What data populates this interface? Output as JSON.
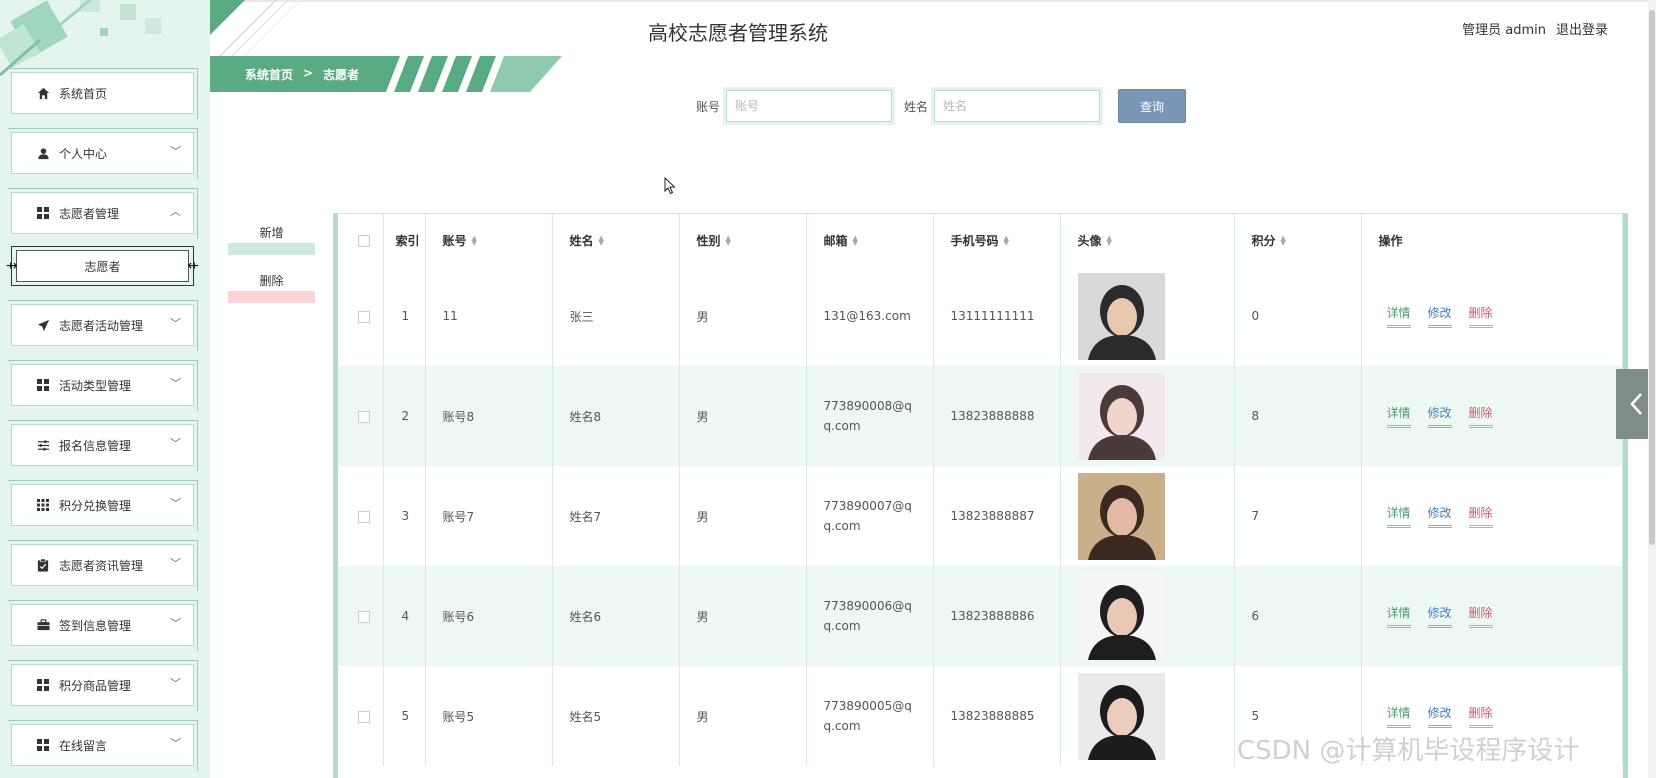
{
  "header": {
    "title": "高校志愿者管理系统",
    "user_label": "管理员 admin",
    "logout": "退出登录"
  },
  "breadcrumb": {
    "home": "系统首页",
    "sep": ">",
    "current": "志愿者"
  },
  "search": {
    "account_label": "账号",
    "account_placeholder": "账号",
    "name_label": "姓名",
    "name_placeholder": "姓名",
    "query_button": "查询"
  },
  "actions": {
    "add": "新增",
    "delete": "删除"
  },
  "sidebar": {
    "items": [
      {
        "label": "系统首页",
        "icon": "home-icon"
      },
      {
        "label": "个人中心",
        "icon": "user-icon",
        "chevron": "﹀"
      },
      {
        "label": "志愿者管理",
        "icon": "grid-icon",
        "chevron": "︿"
      },
      {
        "label": "志愿者活动管理",
        "icon": "send-icon",
        "chevron": "﹀"
      },
      {
        "label": "活动类型管理",
        "icon": "grid-icon",
        "chevron": "﹀"
      },
      {
        "label": "报名信息管理",
        "icon": "sliders-icon",
        "chevron": "﹀"
      },
      {
        "label": "积分兑换管理",
        "icon": "apps-icon",
        "chevron": "﹀"
      },
      {
        "label": "志愿者资讯管理",
        "icon": "clipboard-icon",
        "chevron": "﹀"
      },
      {
        "label": "签到信息管理",
        "icon": "briefcase-icon",
        "chevron": "﹀"
      },
      {
        "label": "积分商品管理",
        "icon": "grid-icon",
        "chevron": "﹀"
      },
      {
        "label": "在线留言",
        "icon": "grid-icon",
        "chevron": "﹀"
      }
    ],
    "active_sub": "志愿者"
  },
  "table": {
    "columns": {
      "index": "索引",
      "account": "账号",
      "name": "姓名",
      "gender": "性别",
      "email": "邮箱",
      "phone": "手机号码",
      "avatar": "头像",
      "points": "积分",
      "ops": "操作"
    },
    "op_labels": {
      "detail": "详情",
      "edit": "修改",
      "delete": "删除"
    },
    "rows": [
      {
        "index": "1",
        "account": "11",
        "name": "张三",
        "gender": "男",
        "email": "131@163.com",
        "phone": "13111111111",
        "points": "0",
        "avatar_colors": [
          "#d9d9d9",
          "#2b2b2b",
          "#e8c9b0"
        ]
      },
      {
        "index": "2",
        "account": "账号8",
        "name": "姓名8",
        "gender": "男",
        "email": "773890008@q q.com",
        "phone": "13823888888",
        "points": "8",
        "avatar_colors": [
          "#f2e9ec",
          "#4a3a3a",
          "#f0d5cc"
        ]
      },
      {
        "index": "3",
        "account": "账号7",
        "name": "姓名7",
        "gender": "男",
        "email": "773890007@q q.com",
        "phone": "13823888887",
        "points": "7",
        "avatar_colors": [
          "#c9b08a",
          "#3a2a22",
          "#e3b9a2"
        ]
      },
      {
        "index": "4",
        "account": "账号6",
        "name": "姓名6",
        "gender": "男",
        "email": "773890006@q q.com",
        "phone": "13823888886",
        "points": "6",
        "avatar_colors": [
          "#f5f5f5",
          "#1e1e1e",
          "#e9c8b6"
        ]
      },
      {
        "index": "5",
        "account": "账号5",
        "name": "姓名5",
        "gender": "男",
        "email": "773890005@q q.com",
        "phone": "13823888885",
        "points": "5",
        "avatar_colors": [
          "#eaeaea",
          "#1c1c1c",
          "#ecccba"
        ]
      }
    ]
  },
  "watermark": "CSDN @计算机毕设程序设计",
  "colors": {
    "sidebar_bg": "#e4f5ee",
    "accent": "#5aaa82",
    "table_border": "#b0dcc8",
    "alt_row": "#eef8f3"
  }
}
